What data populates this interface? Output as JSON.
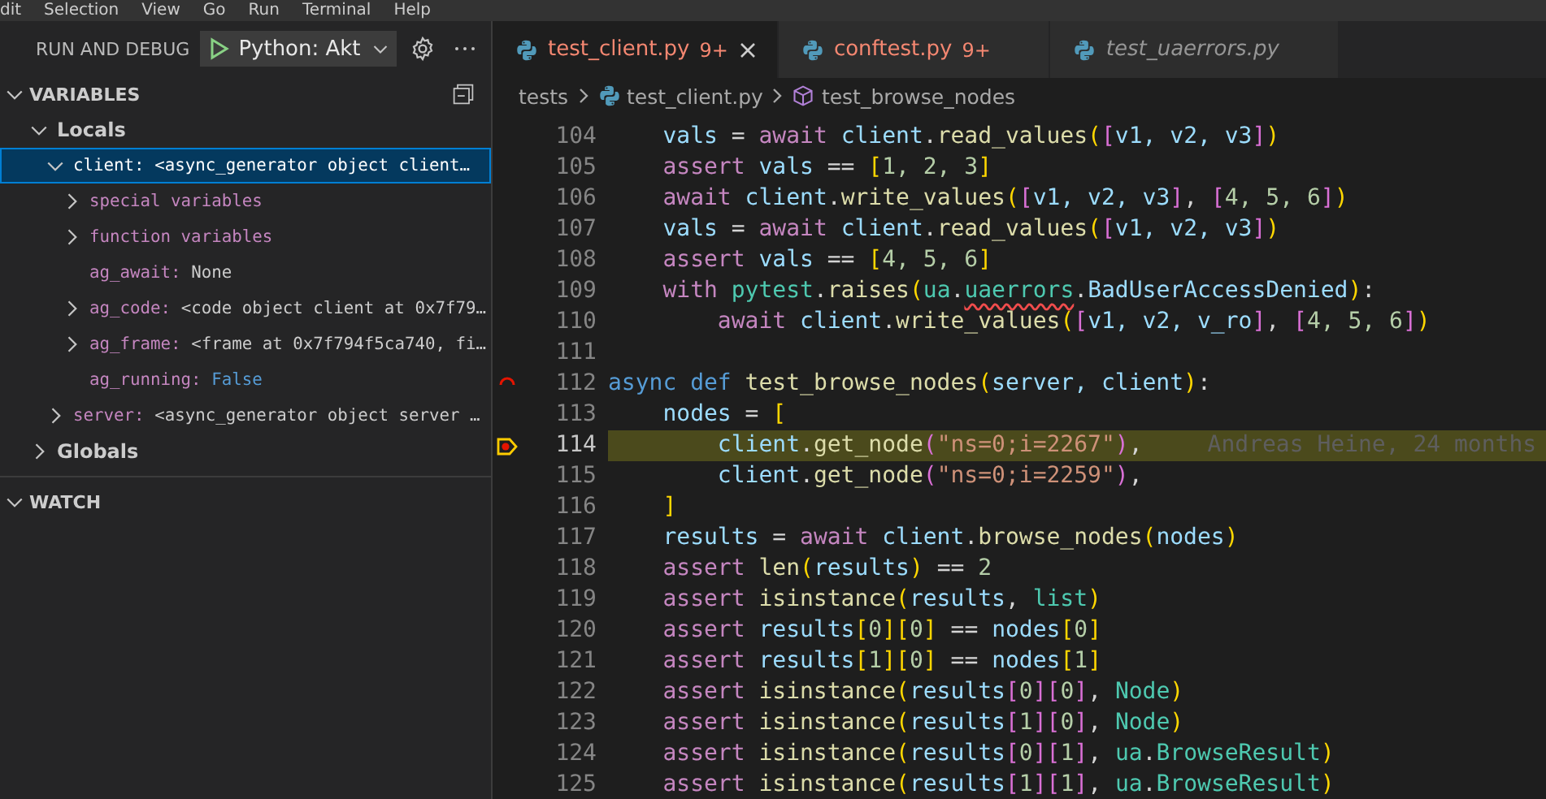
{
  "menu": [
    "dit",
    "Selection",
    "View",
    "Go",
    "Run",
    "Terminal",
    "Help"
  ],
  "sidebar": {
    "title": "RUN AND DEBUG",
    "config": "Python: Akt",
    "variables": {
      "title": "VARIABLES",
      "expanded": true,
      "items": [
        {
          "kind": "scope",
          "name": "Locals",
          "expanded": true,
          "selected": false,
          "children": [
            {
              "kind": "group",
              "name": "client:",
              "value": "<async_generator object client…",
              "color": "#ffffff",
              "expanded": true,
              "selected": true,
              "children": [
                {
                  "kind": "group",
                  "name": "special variables",
                  "expanded": false,
                  "selected": false
                },
                {
                  "kind": "group",
                  "name": "function variables",
                  "expanded": false,
                  "selected": false
                },
                {
                  "kind": "leaf",
                  "name": "ag_await:",
                  "value": "None",
                  "color": "#cccccc",
                  "selected": false
                },
                {
                  "kind": "group",
                  "name": "ag_code:",
                  "value": "<code object client at 0x7f79…",
                  "color": "#cccccc",
                  "expanded": false,
                  "selected": false
                },
                {
                  "kind": "group",
                  "name": "ag_frame:",
                  "value": "<frame at 0x7f794f5ca740, fi…",
                  "color": "#cccccc",
                  "expanded": false,
                  "selected": false
                },
                {
                  "kind": "leaf",
                  "name": "ag_running:",
                  "value": "False",
                  "color": "#569cd6",
                  "selected": false
                }
              ]
            },
            {
              "kind": "group",
              "name": "server:",
              "value": "<async_generator object server …",
              "color": "#cccccc",
              "expanded": false,
              "selected": false
            }
          ]
        },
        {
          "kind": "scope",
          "name": "Globals",
          "expanded": false,
          "selected": false
        }
      ]
    },
    "watch": {
      "title": "WATCH",
      "expanded": true
    }
  },
  "tabs": [
    {
      "label": "test_client.py",
      "badge": "9+",
      "has_errors": true,
      "preview": false,
      "selected": true
    },
    {
      "label": "conftest.py",
      "badge": "9+",
      "has_errors": true,
      "preview": false,
      "selected": false
    },
    {
      "label": "test_uaerrors.py",
      "has_errors": false,
      "preview": true,
      "selected": false
    }
  ],
  "breadcrumb": [
    {
      "kind": "folder",
      "label": "tests"
    },
    {
      "kind": "file",
      "label": "test_client.py"
    },
    {
      "kind": "symbol",
      "label": "test_browse_nodes"
    }
  ],
  "code": [
    {
      "number": "104",
      "tokens": [
        {
          "kind": "variable",
          "text": "    vals"
        },
        {
          "kind": "plain",
          "text": " = "
        },
        {
          "kind": "keyword",
          "text": "await "
        },
        {
          "kind": "variable",
          "text": "client"
        },
        {
          "kind": "plain",
          "text": "."
        },
        {
          "kind": "function",
          "text": "read_values"
        },
        {
          "kind": "bracket1",
          "text": "("
        },
        {
          "kind": "bracket2",
          "text": "["
        },
        {
          "kind": "variable",
          "text": "v1, v2, v3"
        },
        {
          "kind": "bracket2",
          "text": "]"
        },
        {
          "kind": "bracket1",
          "text": ")"
        }
      ]
    },
    {
      "number": "105",
      "tokens": [
        {
          "kind": "keyword",
          "text": "    assert "
        },
        {
          "kind": "variable",
          "text": "vals"
        },
        {
          "kind": "plain",
          "text": " == "
        },
        {
          "kind": "bracket1",
          "text": "["
        },
        {
          "kind": "number",
          "text": "1, 2, 3"
        },
        {
          "kind": "bracket1",
          "text": "]"
        }
      ]
    },
    {
      "number": "106",
      "tokens": [
        {
          "kind": "keyword",
          "text": "    await "
        },
        {
          "kind": "variable",
          "text": "client"
        },
        {
          "kind": "plain",
          "text": "."
        },
        {
          "kind": "function",
          "text": "write_values"
        },
        {
          "kind": "bracket1",
          "text": "("
        },
        {
          "kind": "bracket2",
          "text": "["
        },
        {
          "kind": "variable",
          "text": "v1, v2, v3"
        },
        {
          "kind": "bracket2",
          "text": "]"
        },
        {
          "kind": "plain",
          "text": ", "
        },
        {
          "kind": "bracket2",
          "text": "["
        },
        {
          "kind": "number",
          "text": "4, 5, 6"
        },
        {
          "kind": "bracket2",
          "text": "]"
        },
        {
          "kind": "bracket1",
          "text": ")"
        }
      ]
    },
    {
      "number": "107",
      "tokens": [
        {
          "kind": "variable",
          "text": "    vals"
        },
        {
          "kind": "plain",
          "text": " = "
        },
        {
          "kind": "keyword",
          "text": "await "
        },
        {
          "kind": "variable",
          "text": "client"
        },
        {
          "kind": "plain",
          "text": "."
        },
        {
          "kind": "function",
          "text": "read_values"
        },
        {
          "kind": "bracket1",
          "text": "("
        },
        {
          "kind": "bracket2",
          "text": "["
        },
        {
          "kind": "variable",
          "text": "v1, v2, v3"
        },
        {
          "kind": "bracket2",
          "text": "]"
        },
        {
          "kind": "bracket1",
          "text": ")"
        }
      ]
    },
    {
      "number": "108",
      "tokens": [
        {
          "kind": "keyword",
          "text": "    assert "
        },
        {
          "kind": "variable",
          "text": "vals"
        },
        {
          "kind": "plain",
          "text": " == "
        },
        {
          "kind": "bracket1",
          "text": "["
        },
        {
          "kind": "number",
          "text": "4, 5, 6"
        },
        {
          "kind": "bracket1",
          "text": "]"
        }
      ]
    },
    {
      "number": "109",
      "tokens": [
        {
          "kind": "keyword",
          "text": "    with "
        },
        {
          "kind": "type",
          "text": "pytest"
        },
        {
          "kind": "plain",
          "text": "."
        },
        {
          "kind": "function",
          "text": "raises"
        },
        {
          "kind": "bracket1",
          "text": "("
        },
        {
          "kind": "type",
          "text": "ua"
        },
        {
          "kind": "plain",
          "text": "."
        },
        {
          "kind": "warning",
          "text": "uaerrors"
        },
        {
          "kind": "plain",
          "text": "."
        },
        {
          "kind": "variable",
          "text": "BadUserAccessDenied"
        },
        {
          "kind": "bracket1",
          "text": ")"
        },
        {
          "kind": "plain",
          "text": ":"
        }
      ]
    },
    {
      "number": "110",
      "tokens": [
        {
          "kind": "keyword",
          "text": "        await "
        },
        {
          "kind": "variable",
          "text": "client"
        },
        {
          "kind": "plain",
          "text": "."
        },
        {
          "kind": "function",
          "text": "write_values"
        },
        {
          "kind": "bracket1",
          "text": "("
        },
        {
          "kind": "bracket2",
          "text": "["
        },
        {
          "kind": "variable",
          "text": "v1, v2, v_ro"
        },
        {
          "kind": "bracket2",
          "text": "]"
        },
        {
          "kind": "plain",
          "text": ", "
        },
        {
          "kind": "bracket2",
          "text": "["
        },
        {
          "kind": "number",
          "text": "4, 5, 6"
        },
        {
          "kind": "bracket2",
          "text": "]"
        },
        {
          "kind": "bracket1",
          "text": ")"
        }
      ]
    },
    {
      "number": "111"
    },
    {
      "number": "112",
      "kind": "frame",
      "tokens": [
        {
          "kind": "storage",
          "text": "async def "
        },
        {
          "kind": "function",
          "text": "test_browse_nodes"
        },
        {
          "kind": "bracket1",
          "text": "("
        },
        {
          "kind": "variable",
          "text": "server, client"
        },
        {
          "kind": "bracket1",
          "text": ")"
        },
        {
          "kind": "plain",
          "text": ":"
        }
      ]
    },
    {
      "number": "113",
      "tokens": [
        {
          "kind": "variable",
          "text": "    nodes"
        },
        {
          "kind": "plain",
          "text": " = "
        },
        {
          "kind": "bracket1",
          "text": "["
        }
      ]
    },
    {
      "number": "114",
      "kind": "current",
      "highlighted": true,
      "blame": "Andreas Heine, 24 months",
      "tokens": [
        {
          "kind": "variable",
          "text": "        client"
        },
        {
          "kind": "plain",
          "text": "."
        },
        {
          "kind": "function",
          "text": "get_node"
        },
        {
          "kind": "bracket2",
          "text": "("
        },
        {
          "kind": "string",
          "text": "\"ns=0;i=2267\""
        },
        {
          "kind": "bracket2",
          "text": ")"
        },
        {
          "kind": "plain",
          "text": ","
        }
      ]
    },
    {
      "number": "115",
      "tokens": [
        {
          "kind": "variable",
          "text": "        client"
        },
        {
          "kind": "plain",
          "text": "."
        },
        {
          "kind": "function",
          "text": "get_node"
        },
        {
          "kind": "bracket2",
          "text": "("
        },
        {
          "kind": "string",
          "text": "\"ns=0;i=2259\""
        },
        {
          "kind": "bracket2",
          "text": ")"
        },
        {
          "kind": "plain",
          "text": ","
        }
      ]
    },
    {
      "number": "116",
      "tokens": [
        {
          "kind": "bracket1",
          "text": "    ]"
        }
      ]
    },
    {
      "number": "117",
      "tokens": [
        {
          "kind": "variable",
          "text": "    results"
        },
        {
          "kind": "plain",
          "text": " = "
        },
        {
          "kind": "keyword",
          "text": "await "
        },
        {
          "kind": "variable",
          "text": "client"
        },
        {
          "kind": "plain",
          "text": "."
        },
        {
          "kind": "function",
          "text": "browse_nodes"
        },
        {
          "kind": "bracket1",
          "text": "("
        },
        {
          "kind": "variable",
          "text": "nodes"
        },
        {
          "kind": "bracket1",
          "text": ")"
        }
      ]
    },
    {
      "number": "118",
      "tokens": [
        {
          "kind": "keyword",
          "text": "    assert "
        },
        {
          "kind": "function",
          "text": "len"
        },
        {
          "kind": "bracket1",
          "text": "("
        },
        {
          "kind": "variable",
          "text": "results"
        },
        {
          "kind": "bracket1",
          "text": ")"
        },
        {
          "kind": "plain",
          "text": " == "
        },
        {
          "kind": "number",
          "text": "2"
        }
      ]
    },
    {
      "number": "119",
      "tokens": [
        {
          "kind": "keyword",
          "text": "    assert "
        },
        {
          "kind": "function",
          "text": "isinstance"
        },
        {
          "kind": "bracket1",
          "text": "("
        },
        {
          "kind": "variable",
          "text": "results"
        },
        {
          "kind": "plain",
          "text": ", "
        },
        {
          "kind": "type",
          "text": "list"
        },
        {
          "kind": "bracket1",
          "text": ")"
        }
      ]
    },
    {
      "number": "120",
      "tokens": [
        {
          "kind": "keyword",
          "text": "    assert "
        },
        {
          "kind": "variable",
          "text": "results"
        },
        {
          "kind": "bracket1",
          "text": "["
        },
        {
          "kind": "number",
          "text": "0"
        },
        {
          "kind": "bracket1",
          "text": "]["
        },
        {
          "kind": "number",
          "text": "0"
        },
        {
          "kind": "bracket1",
          "text": "]"
        },
        {
          "kind": "plain",
          "text": " == "
        },
        {
          "kind": "variable",
          "text": "nodes"
        },
        {
          "kind": "bracket1",
          "text": "["
        },
        {
          "kind": "number",
          "text": "0"
        },
        {
          "kind": "bracket1",
          "text": "]"
        }
      ]
    },
    {
      "number": "121",
      "tokens": [
        {
          "kind": "keyword",
          "text": "    assert "
        },
        {
          "kind": "variable",
          "text": "results"
        },
        {
          "kind": "bracket1",
          "text": "["
        },
        {
          "kind": "number",
          "text": "1"
        },
        {
          "kind": "bracket1",
          "text": "]["
        },
        {
          "kind": "number",
          "text": "0"
        },
        {
          "kind": "bracket1",
          "text": "]"
        },
        {
          "kind": "plain",
          "text": " == "
        },
        {
          "kind": "variable",
          "text": "nodes"
        },
        {
          "kind": "bracket1",
          "text": "["
        },
        {
          "kind": "number",
          "text": "1"
        },
        {
          "kind": "bracket1",
          "text": "]"
        }
      ]
    },
    {
      "number": "122",
      "tokens": [
        {
          "kind": "keyword",
          "text": "    assert "
        },
        {
          "kind": "function",
          "text": "isinstance"
        },
        {
          "kind": "bracket1",
          "text": "("
        },
        {
          "kind": "variable",
          "text": "results"
        },
        {
          "kind": "bracket2",
          "text": "["
        },
        {
          "kind": "number",
          "text": "0"
        },
        {
          "kind": "bracket2",
          "text": "]["
        },
        {
          "kind": "number",
          "text": "0"
        },
        {
          "kind": "bracket2",
          "text": "]"
        },
        {
          "kind": "plain",
          "text": ", "
        },
        {
          "kind": "type",
          "text": "Node"
        },
        {
          "kind": "bracket1",
          "text": ")"
        }
      ]
    },
    {
      "number": "123",
      "tokens": [
        {
          "kind": "keyword",
          "text": "    assert "
        },
        {
          "kind": "function",
          "text": "isinstance"
        },
        {
          "kind": "bracket1",
          "text": "("
        },
        {
          "kind": "variable",
          "text": "results"
        },
        {
          "kind": "bracket2",
          "text": "["
        },
        {
          "kind": "number",
          "text": "1"
        },
        {
          "kind": "bracket2",
          "text": "]["
        },
        {
          "kind": "number",
          "text": "0"
        },
        {
          "kind": "bracket2",
          "text": "]"
        },
        {
          "kind": "plain",
          "text": ", "
        },
        {
          "kind": "type",
          "text": "Node"
        },
        {
          "kind": "bracket1",
          "text": ")"
        }
      ]
    },
    {
      "number": "124",
      "tokens": [
        {
          "kind": "keyword",
          "text": "    assert "
        },
        {
          "kind": "function",
          "text": "isinstance"
        },
        {
          "kind": "bracket1",
          "text": "("
        },
        {
          "kind": "variable",
          "text": "results"
        },
        {
          "kind": "bracket2",
          "text": "["
        },
        {
          "kind": "number",
          "text": "0"
        },
        {
          "kind": "bracket2",
          "text": "]["
        },
        {
          "kind": "number",
          "text": "1"
        },
        {
          "kind": "bracket2",
          "text": "]"
        },
        {
          "kind": "plain",
          "text": ", "
        },
        {
          "kind": "type",
          "text": "ua"
        },
        {
          "kind": "plain",
          "text": "."
        },
        {
          "kind": "type",
          "text": "BrowseResult"
        },
        {
          "kind": "bracket1",
          "text": ")"
        }
      ]
    },
    {
      "number": "125",
      "tokens": [
        {
          "kind": "keyword",
          "text": "    assert "
        },
        {
          "kind": "function",
          "text": "isinstance"
        },
        {
          "kind": "bracket1",
          "text": "("
        },
        {
          "kind": "variable",
          "text": "results"
        },
        {
          "kind": "bracket2",
          "text": "["
        },
        {
          "kind": "number",
          "text": "1"
        },
        {
          "kind": "bracket2",
          "text": "]["
        },
        {
          "kind": "number",
          "text": "1"
        },
        {
          "kind": "bracket2",
          "text": "]"
        },
        {
          "kind": "plain",
          "text": ", "
        },
        {
          "kind": "type",
          "text": "ua"
        },
        {
          "kind": "plain",
          "text": "."
        },
        {
          "kind": "type",
          "text": "BrowseResult"
        },
        {
          "kind": "bracket1",
          "text": ")"
        }
      ]
    }
  ]
}
